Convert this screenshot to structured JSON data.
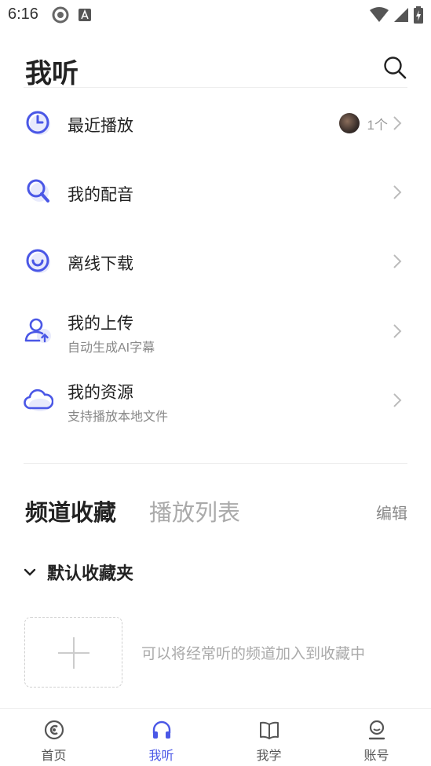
{
  "status_bar": {
    "time": "6:16"
  },
  "header": {
    "title": "我听"
  },
  "menu": [
    {
      "label": "最近播放",
      "meta": "1个"
    },
    {
      "label": "我的配音"
    },
    {
      "label": "离线下载"
    },
    {
      "label": "我的上传",
      "sub": "自动生成AI字幕"
    },
    {
      "label": "我的资源",
      "sub": "支持播放本地文件"
    }
  ],
  "tabs": {
    "active": "频道收藏",
    "inactive": "播放列表",
    "edit": "编辑"
  },
  "folder": {
    "title": "默认收藏夹",
    "hint": "可以将经常听的频道加入到收藏中"
  },
  "bottom_nav": [
    {
      "label": "首页",
      "icon": "home-icon"
    },
    {
      "label": "我听",
      "icon": "headphones-icon",
      "active": true
    },
    {
      "label": "我学",
      "icon": "book-icon"
    },
    {
      "label": "账号",
      "icon": "account-icon"
    }
  ],
  "colors": {
    "accent": "#4a57e6",
    "icon_tint": "#e8eafc"
  }
}
